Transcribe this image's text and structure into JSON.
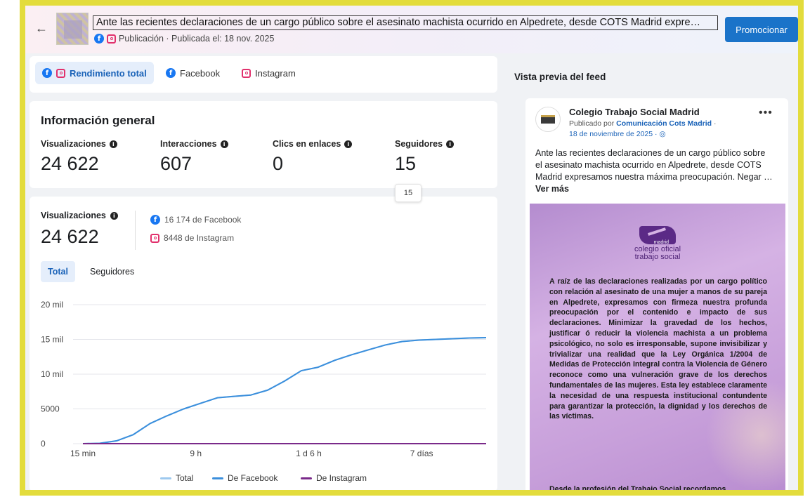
{
  "header": {
    "title": "Ante las recientes declaraciones de un cargo público sobre el asesinato machista ocurrido en Alpedrete, desde COTS Madrid expre…",
    "subtitle": "Publicación · Publicada el: 18 nov. 2025",
    "promote_label": "Promocionar"
  },
  "tabs": [
    {
      "label": "Rendimiento total",
      "active": true
    },
    {
      "label": "Facebook",
      "active": false
    },
    {
      "label": "Instagram",
      "active": false
    }
  ],
  "info": {
    "title": "Información general",
    "metrics": [
      {
        "label": "Visualizaciones",
        "value": "24 622"
      },
      {
        "label": "Interacciones",
        "value": "607"
      },
      {
        "label": "Clics en enlaces",
        "value": "0"
      },
      {
        "label": "Seguidores",
        "value": "15"
      }
    ],
    "tooltip": "15"
  },
  "views": {
    "label": "Visualizaciones",
    "value": "24 622",
    "facebook": "16 174 de Facebook",
    "instagram": "8448 de Instagram",
    "segments": [
      "Total",
      "Seguidores"
    ]
  },
  "chart_data": {
    "type": "line",
    "y_ticks": [
      "20 mil",
      "15 mil",
      "10 mil",
      "5000",
      "0"
    ],
    "ylim": [
      0,
      20000
    ],
    "x_ticks": [
      "15 min",
      "9 h",
      "1 d 6 h",
      "7 días"
    ],
    "x": [
      0,
      1,
      2,
      3,
      4,
      5,
      6,
      7,
      8,
      9,
      10,
      11,
      12,
      13,
      14,
      15,
      16,
      17,
      18,
      19,
      20,
      21,
      22,
      23,
      24
    ],
    "series": [
      {
        "name": "Total",
        "color": "#9ec9ef",
        "values": [
          0,
          50,
          400,
          1300,
          2900,
          4000,
          5000,
          5800,
          6600,
          6800,
          7000,
          7700,
          9000,
          10500,
          11000,
          12000,
          12800,
          13500,
          14200,
          14700,
          14900,
          15000,
          15100,
          15200,
          15250
        ]
      },
      {
        "name": "De Facebook",
        "color": "#3b8fdc",
        "values": [
          0,
          50,
          400,
          1300,
          2900,
          4000,
          5000,
          5800,
          6600,
          6800,
          7000,
          7700,
          9000,
          10500,
          11000,
          12000,
          12800,
          13500,
          14200,
          14700,
          14900,
          15000,
          15100,
          15200,
          15250
        ]
      },
      {
        "name": "De Instagram",
        "color": "#7a2a8a",
        "values": [
          0,
          0,
          0,
          0,
          0,
          0,
          0,
          0,
          0,
          0,
          0,
          0,
          0,
          0,
          0,
          0,
          0,
          0,
          0,
          0,
          0,
          0,
          0,
          0,
          0
        ]
      }
    ]
  },
  "feed": {
    "title": "Vista previa del feed",
    "page_name": "Colegio Trabajo Social Madrid",
    "published_by_prefix": "Publicado por",
    "published_by_name": "Comunicación Cots Madrid",
    "date": "18 de noviembre de 2025 ·",
    "text": "Ante las recientes declaraciones de un cargo público sobre el asesinato machista ocurrido en Alpedrete, desde COTS Madrid expresamos nuestra máxima preocupación. Negar …",
    "see_more": "Ver más",
    "image": {
      "logo_small": "madrid",
      "logo_line1": "colegio oficial",
      "logo_line2": "trabajo social",
      "paragraph1": "A raíz de las declaraciones realizadas por un cargo político con relación al asesinato de una mujer a manos de su pareja en Alpedrete, expresamos con firmeza nuestra profunda preocupación por el contenido e impacto de sus declaraciones. Minimizar la gravedad de los hechos, justificar ó reducir la violencia machista a un problema psicológico, no solo es irresponsable, supone invisibilizar y trivializar una realidad que la Ley Orgánica 1/2004 de Medidas de Protección Integral contra la Violencia de Género reconoce como una vulneración grave de los derechos fundamentales de las mujeres. Esta ley establece claramente la necesidad de una respuesta institucional contundente para garantizar la protección, la dignidad y los derechos de las víctimas.",
      "paragraph2": "Desde la profesión del Trabajo Social recordamos"
    }
  }
}
